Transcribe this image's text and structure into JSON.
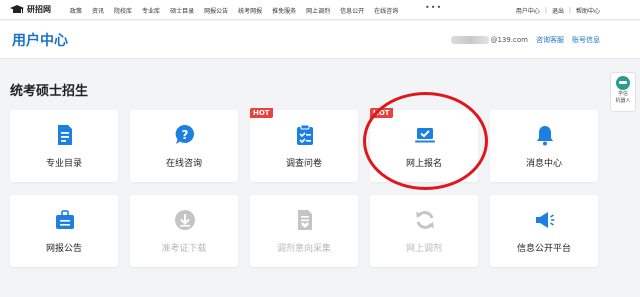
{
  "topnav": {
    "logo_text": "研招网",
    "links": [
      "政策",
      "资讯",
      "院校库",
      "专业库",
      "硕士目录",
      "网报公告",
      "统考网报",
      "推免服务",
      "网上调剂",
      "信息公开",
      "在线咨询"
    ],
    "more": "•••",
    "right_links": [
      "用户中心",
      "退出",
      "帮助中心"
    ],
    "separator": "|"
  },
  "header": {
    "title": "用户中心",
    "email_suffix": "@139.com",
    "help": "咨询客服",
    "account": "账号信息"
  },
  "section": {
    "title": "统考硕士招生"
  },
  "cards": [
    {
      "label": "专业目录",
      "icon": "document-list-icon",
      "enabled": true,
      "hot": ""
    },
    {
      "label": "在线咨询",
      "icon": "chat-question-icon",
      "enabled": true,
      "hot": ""
    },
    {
      "label": "调查问卷",
      "icon": "clipboard-check-icon",
      "enabled": true,
      "hot": "HOT"
    },
    {
      "label": "网上报名",
      "icon": "laptop-check-icon",
      "enabled": true,
      "hot": "HOT"
    },
    {
      "label": "消息中心",
      "icon": "bell-icon",
      "enabled": true,
      "hot": ""
    },
    {
      "label": "网报公告",
      "icon": "briefcase-announcement-icon",
      "enabled": true,
      "hot": ""
    },
    {
      "label": "准考证下载",
      "icon": "download-icon",
      "enabled": false,
      "hot": ""
    },
    {
      "label": "调剂意向采集",
      "icon": "document-heart-icon",
      "enabled": false,
      "hot": ""
    },
    {
      "label": "网上调剂",
      "icon": "refresh-icon",
      "enabled": false,
      "hot": ""
    },
    {
      "label": "信息公开平台",
      "icon": "megaphone-icon",
      "enabled": true,
      "hot": ""
    }
  ],
  "side_widget": {
    "line1": "学信",
    "line2": "机器人"
  },
  "colors": {
    "accent": "#1a73c8",
    "icon_blue": "#1d7fe0",
    "disabled": "#c4c4c4",
    "hot": "#e8423f",
    "highlight": "#e0161c"
  }
}
